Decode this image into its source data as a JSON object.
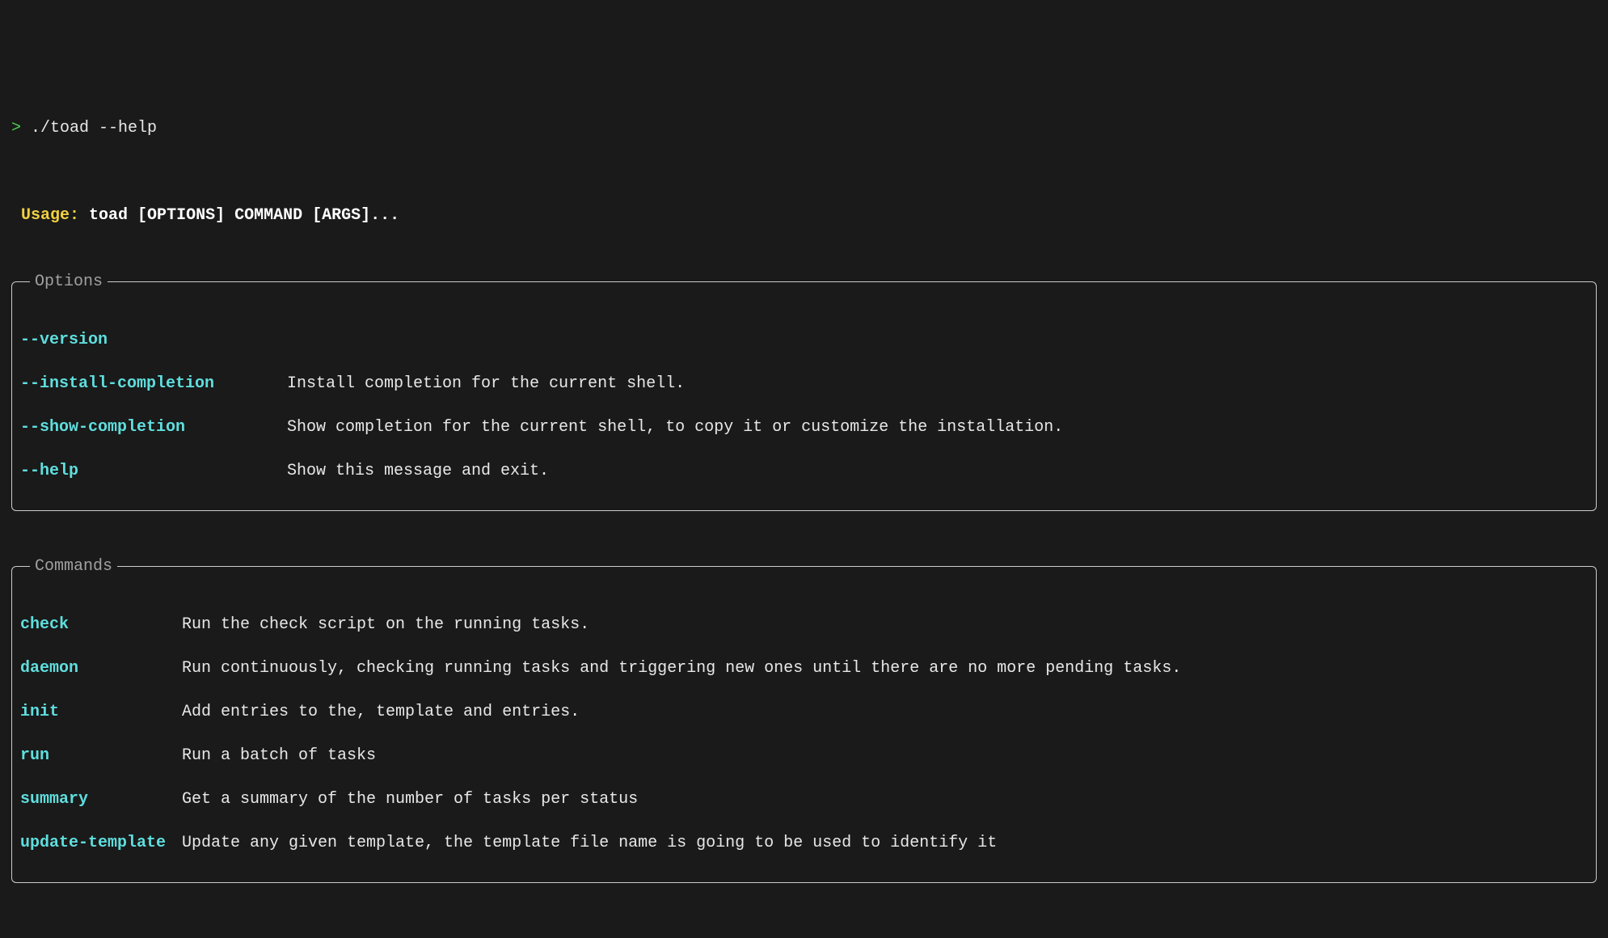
{
  "prompt": {
    "symbol": ">",
    "command": "./toad --help"
  },
  "usage": {
    "label": "Usage:",
    "text": "toad [OPTIONS] COMMAND [ARGS]..."
  },
  "options_panel": {
    "title": "Options",
    "items": [
      {
        "name": "--version",
        "desc": ""
      },
      {
        "name": "--install-completion",
        "desc": "Install completion for the current shell."
      },
      {
        "name": "--show-completion",
        "desc": "Show completion for the current shell, to copy it or customize the installation."
      },
      {
        "name": "--help",
        "desc": "Show this message and exit."
      }
    ]
  },
  "commands_panel": {
    "title": "Commands",
    "items": [
      {
        "name": "check",
        "desc": "Run the check script on the running tasks."
      },
      {
        "name": "daemon",
        "desc": "Run continuously, checking running tasks and triggering new ones until there are no more pending tasks."
      },
      {
        "name": "init",
        "desc": "Add entries to the, template and entries."
      },
      {
        "name": "run",
        "desc": "Run a batch of tasks"
      },
      {
        "name": "summary",
        "desc": "Get a summary of the number of tasks per status"
      },
      {
        "name": "update-template",
        "desc": "Update any given template, the template file name is going to be used to identify it"
      }
    ]
  }
}
